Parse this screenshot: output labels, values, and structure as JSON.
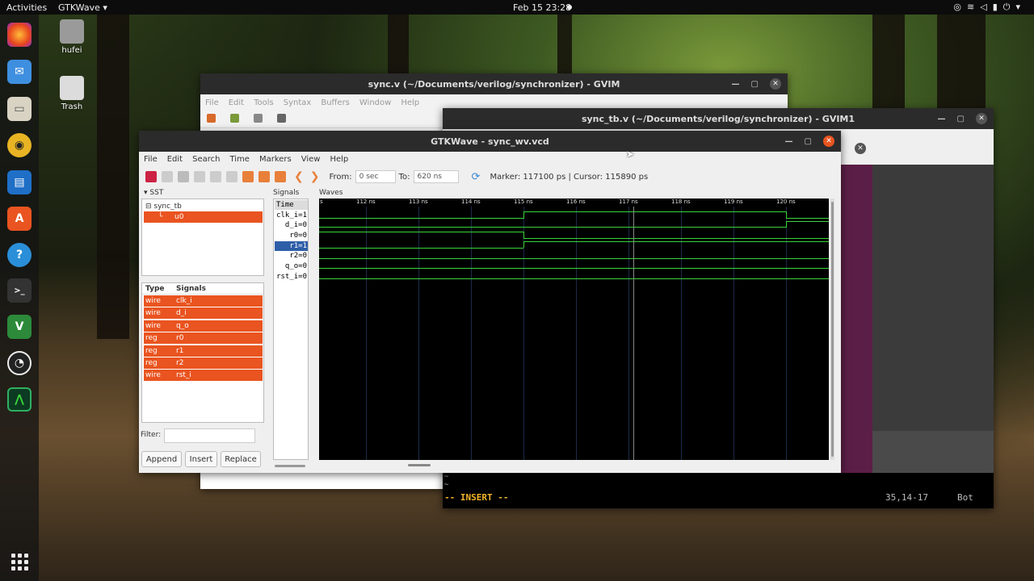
{
  "topbar": {
    "activities": "Activities",
    "app": "GTKWave ▾",
    "clock": "Feb 15  23:28"
  },
  "desktop": {
    "home_label": "hufei",
    "trash_label": "Trash"
  },
  "gvim_back": {
    "title": "sync.v (~/Documents/verilog/synchronizer) - GVIM",
    "menu": [
      "File",
      "Edit",
      "Tools",
      "Syntax",
      "Buffers",
      "Window",
      "Help"
    ]
  },
  "gvim_front": {
    "title": "sync_tb.v (~/Documents/verilog/synchronizer) - GVIM1",
    "mode": "-- INSERT --",
    "position": "35,14-17",
    "scroll": "Bot",
    "tilde": "~"
  },
  "gtkwave": {
    "title": "GTKWave - sync_wv.vcd",
    "menu": [
      "File",
      "Edit",
      "Search",
      "Time",
      "Markers",
      "View",
      "Help"
    ],
    "from_label": "From:",
    "from_value": "0 sec",
    "to_label": "To:",
    "to_value": "620 ns",
    "marker_text": "Marker: 117100 ps  |  Cursor: 115890 ps",
    "sst_label": "SST",
    "tree": {
      "root": "sync_tb",
      "child": "u0"
    },
    "type_header": "Type",
    "signals_header": "Signals",
    "signal_list": [
      {
        "type": "wire",
        "name": "clk_i"
      },
      {
        "type": "wire",
        "name": "d_i"
      },
      {
        "type": "wire",
        "name": "q_o"
      },
      {
        "type": "reg",
        "name": "r0"
      },
      {
        "type": "reg",
        "name": "r1"
      },
      {
        "type": "reg",
        "name": "r2"
      },
      {
        "type": "wire",
        "name": "rst_i"
      }
    ],
    "filter_label": "Filter:",
    "buttons": {
      "append": "Append",
      "insert": "Insert",
      "replace": "Replace"
    },
    "signals_pane_label": "Signals",
    "waves_pane_label": "Waves",
    "signal_values": [
      "Time",
      "clk_i=1",
      "d_i=0",
      "r0=0",
      "r1=1",
      "r2=0",
      "q_o=0",
      "rst_i=0"
    ],
    "time_ticks": [
      "s",
      "112 ns",
      "113 ns",
      "114 ns",
      "115 ns",
      "116 ns",
      "117 ns",
      "118 ns",
      "119 ns",
      "120 ns"
    ]
  }
}
